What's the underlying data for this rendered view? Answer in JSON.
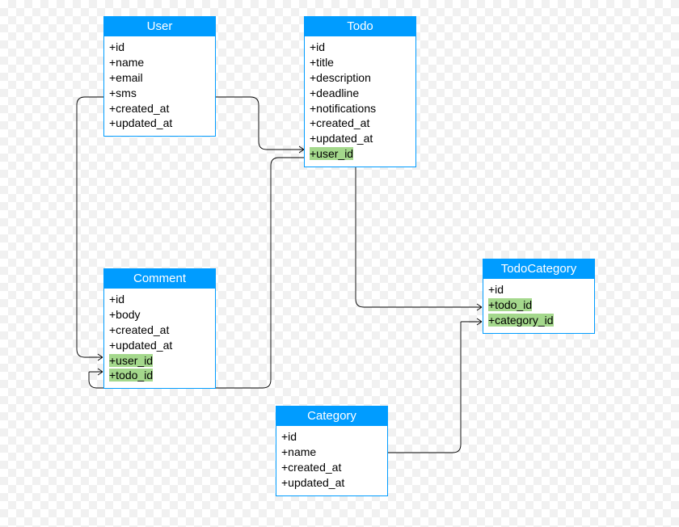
{
  "entities": {
    "user": {
      "title": "User",
      "attrs": [
        {
          "text": "+id"
        },
        {
          "text": "+name"
        },
        {
          "text": "+email"
        },
        {
          "text": "+sms"
        },
        {
          "text": "+created_at"
        },
        {
          "text": "+updated_at"
        }
      ]
    },
    "todo": {
      "title": "Todo",
      "attrs": [
        {
          "text": "+id"
        },
        {
          "text": "+title"
        },
        {
          "text": "+description"
        },
        {
          "text": "+deadline"
        },
        {
          "text": "+notifications"
        },
        {
          "text": "+created_at"
        },
        {
          "text": "+updated_at"
        },
        {
          "text": "+user_id",
          "fk": true
        }
      ]
    },
    "comment": {
      "title": "Comment",
      "attrs": [
        {
          "text": "+id"
        },
        {
          "text": "+body"
        },
        {
          "text": "+created_at"
        },
        {
          "text": "+updated_at"
        },
        {
          "text": "+user_id",
          "fk": true
        },
        {
          "text": "+todo_id",
          "fk": true
        }
      ]
    },
    "todoCategory": {
      "title": "TodoCategory",
      "attrs": [
        {
          "text": "+id"
        },
        {
          "text": "+todo_id",
          "fk": true
        },
        {
          "text": "+category_id",
          "fk": true
        }
      ]
    },
    "category": {
      "title": "Category",
      "attrs": [
        {
          "text": "+id"
        },
        {
          "text": "+name"
        },
        {
          "text": "+created_at"
        },
        {
          "text": "+updated_at"
        }
      ]
    }
  }
}
